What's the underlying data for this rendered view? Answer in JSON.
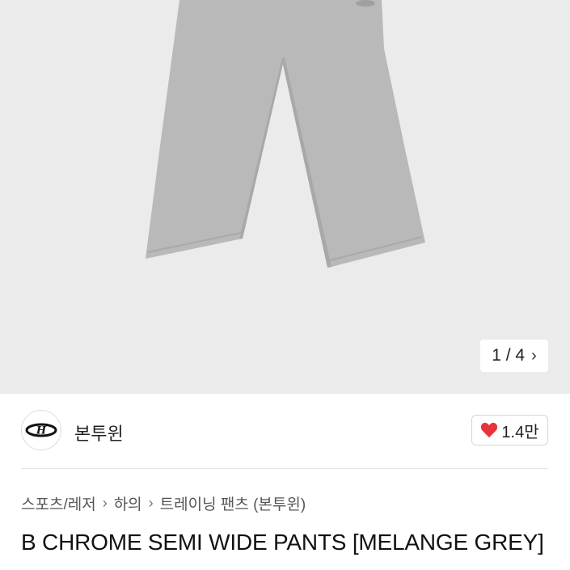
{
  "gallery": {
    "pager_text": "1 / 4",
    "chevron": "›",
    "image": "grey-wide-pants-photo",
    "colors": {
      "background": "#ebebeb",
      "product": "#b9b9b9"
    }
  },
  "seller": {
    "name": "본투윈",
    "logo_icon": "brand-logo-icon",
    "likes": "1.4만",
    "heart_icon": "heart-icon",
    "heart_color": "#e8333c"
  },
  "breadcrumb": {
    "items": [
      "스포츠/레저",
      "하의",
      "트레이닝 팬츠 (본투윈)"
    ],
    "separator": "›"
  },
  "product": {
    "title": "B CHROME SEMI WIDE PANTS [MELANGE GREY]"
  }
}
